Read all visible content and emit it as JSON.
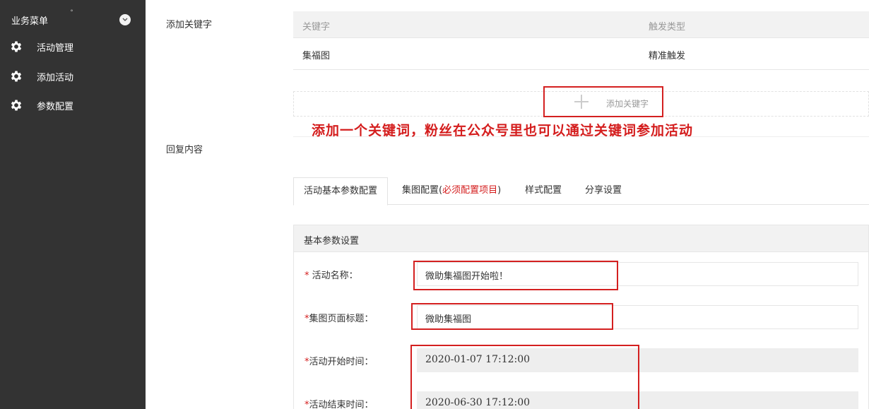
{
  "sidebar": {
    "title": "业务菜单",
    "dot": "˚",
    "items": [
      {
        "label": "活动管理",
        "icon": "gear-icon"
      },
      {
        "label": "添加活动",
        "icon": "gear-icon"
      },
      {
        "label": "参数配置",
        "icon": "gear-icon"
      }
    ]
  },
  "keywords": {
    "section_label": "添加关键字",
    "columns": [
      "关键字",
      "触发类型"
    ],
    "rows": [
      {
        "keyword": "集福图",
        "trigger": "精准触发"
      }
    ],
    "add_button_label": "添加关键字"
  },
  "annotation": "添加一个关键词，粉丝在公众号里也可以通过关键词参加活动",
  "reply": {
    "section_label": "回复内容"
  },
  "tabs": [
    {
      "label": "活动基本参数配置",
      "active": true
    },
    {
      "label_prefix": "集图配置(",
      "label_red": "必须配置项目",
      "label_suffix": ")"
    },
    {
      "label": "样式配置"
    },
    {
      "label": "分享设置"
    }
  ],
  "panel": {
    "title": "基本参数设置",
    "fields": [
      {
        "star": "* ",
        "label": "活动名称：",
        "value": "微助集福图开始啦！"
      },
      {
        "star": "*",
        "label": "集图页面标题：",
        "value": "微助集福图"
      },
      {
        "star": "*",
        "label": "活动开始时间：",
        "value": "2020-01-07 17:12:00"
      },
      {
        "star": "*",
        "label": "活动结束时间：",
        "value": "2020-06-30 17:12:00"
      }
    ]
  },
  "colors": {
    "sidebar_bg": "#333333",
    "highlight_red": "#d42020",
    "required_star": "#d41d1d"
  }
}
